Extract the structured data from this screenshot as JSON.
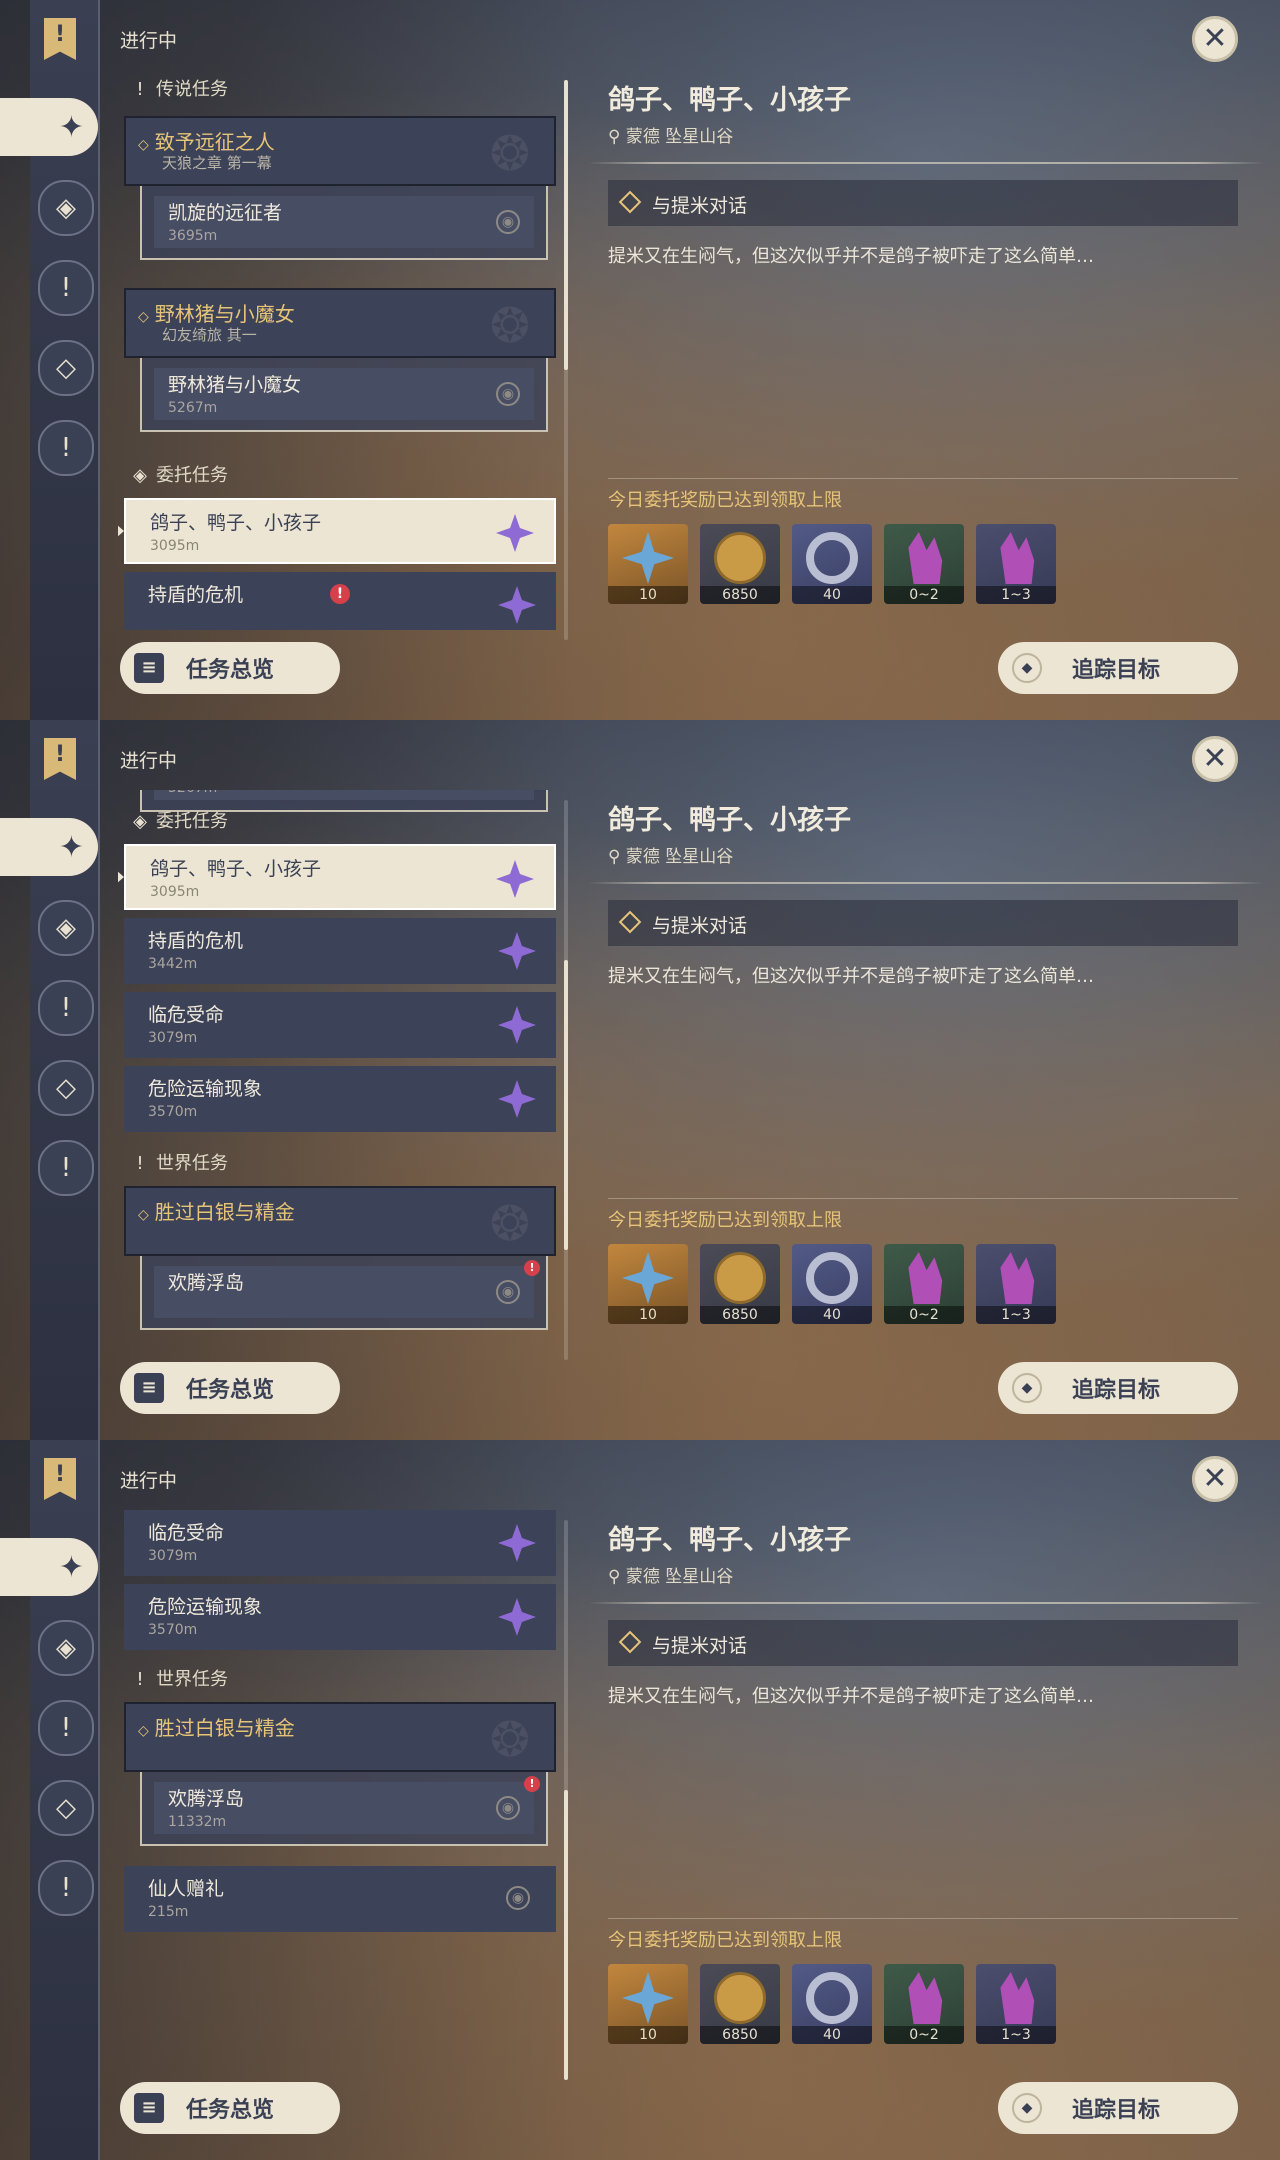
{
  "header": {
    "in_progress": "进行中"
  },
  "categories": {
    "legend": "传说任务",
    "commission": "委托任务",
    "world": "世界任务"
  },
  "quests": {
    "archon_group": {
      "title": "致予远征之人",
      "subtitle": "天狼之章 第一幕",
      "child": "凯旋的远征者",
      "child_dist": "3695m"
    },
    "boar_group": {
      "title": "野林猪与小魔女",
      "subtitle": "幻友绮旅 其一",
      "child": "野林猪与小魔女",
      "child_dist": "5267m"
    },
    "c1": {
      "name": "鸽子、鸭子、小孩子",
      "dist": "3095m"
    },
    "c2": {
      "name": "持盾的危机",
      "dist": "3442m"
    },
    "c3": {
      "name": "临危受命",
      "dist": "3079m"
    },
    "c4": {
      "name": "危险运输现象",
      "dist": "3570m"
    },
    "world_group": {
      "title": "胜过白银与精金",
      "child": "欢腾浮岛",
      "child_dist": "11332m"
    },
    "w2": {
      "name": "仙人赠礼",
      "dist": "215m"
    },
    "partial_dist": "5267m"
  },
  "detail": {
    "title": "鸽子、鸭子、小孩子",
    "location": "蒙德 坠星山谷",
    "objective": "与提米对话",
    "description": "提米又在生闷气，但这次似乎并不是鸽子被吓走了这么简单…",
    "reward_note": "今日委托奖励已达到领取上限",
    "rewards": [
      {
        "icon": "adventure-exp-star",
        "count": "10"
      },
      {
        "icon": "mora-coin",
        "count": "6850"
      },
      {
        "icon": "friendship-exp",
        "count": "40"
      },
      {
        "icon": "ore-crystal",
        "count": "0~2"
      },
      {
        "icon": "amethyst-crystal",
        "count": "1~3"
      }
    ]
  },
  "buttons": {
    "overview": "任务总览",
    "track": "追踪目标"
  },
  "icons": {
    "close": "✕",
    "pin": "◉",
    "alert": "!",
    "legend": "!",
    "commission": "◈",
    "world": "!"
  },
  "colors": {
    "accent_gold": "#e7c477",
    "selected_bg": "#ece5d3",
    "panel_bg": "#3c4257",
    "commission_purple": "#8e6ad4"
  }
}
